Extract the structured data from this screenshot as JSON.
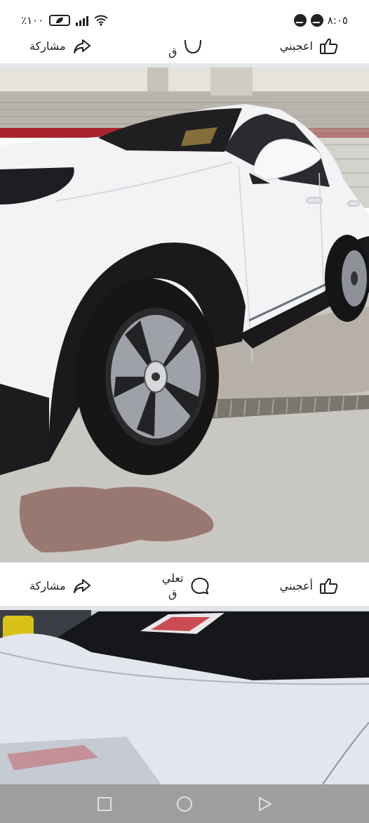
{
  "status_bar": {
    "battery_percent": "٪١٠٠",
    "time": "٨:٠٥",
    "icons": [
      "battery-icon",
      "signal-icon",
      "wifi-icon",
      "messenger-icon",
      "messenger-icon"
    ]
  },
  "post_actions_top": {
    "share_label": "مشاركة",
    "comment_label": "ق",
    "like_label": "اعجبني"
  },
  "post_actions_mid": {
    "share_label": "مشاركة",
    "comment_label": "تعلي\nق",
    "like_label": "أعجبني"
  },
  "nav": {
    "icons": [
      "square-icon",
      "circle-icon",
      "triangle-icon"
    ]
  },
  "colors": {
    "background": "#ffffff",
    "divider": "#e4e6eb",
    "nav_bar": "#9e9e9e",
    "text": "#1c1e21",
    "car_body": "#f2f3f5",
    "tire": "#1a1a1a",
    "floor": "#c9c7c2"
  }
}
